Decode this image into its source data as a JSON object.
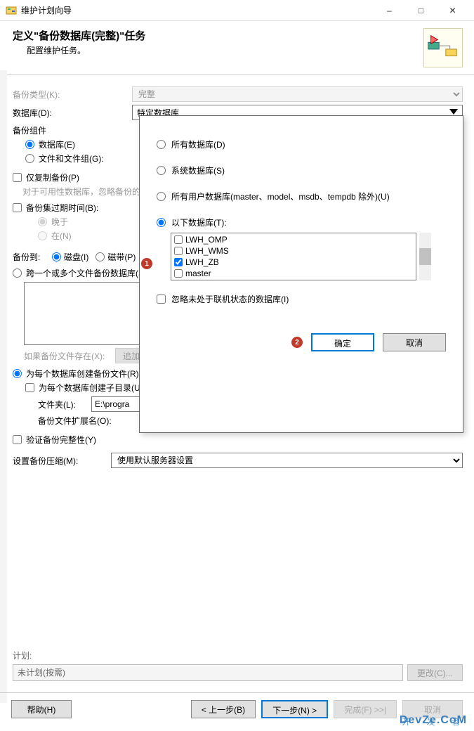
{
  "window": {
    "title": "维护计划向导"
  },
  "header": {
    "title": "定义\"备份数据库(完整)\"任务",
    "subtitle": "配置维护任务。"
  },
  "labels": {
    "backup_type": "备份类型(K):",
    "database": "数据库(D):",
    "backup_component": "备份组件",
    "component_db": "数据库(E)",
    "component_fg": "文件和文件组(G):",
    "copy_only": "仅复制备份(P)",
    "avail_note": "对于可用性数据库，忽略备份的副本设置",
    "expire": "备份集过期时间(B):",
    "expire_after": "晚于",
    "expire_on": "在(N)",
    "backup_to": "备份到:",
    "disk": "磁盘(I)",
    "tape": "磁带(P)",
    "span": "跨一个或多个文件备份数据库(S):",
    "if_exists": "如果备份文件存在(X):",
    "append_btn": "追加",
    "create_per_db": "为每个数据库创建备份文件(R)",
    "create_sub": "为每个数据库创建子目录(U)",
    "folder": "文件夹(L):",
    "folder_value": "E:\\progra",
    "ext": "备份文件扩展名(O):",
    "verify": "验证备份完整性(Y)",
    "compress": "设置备份压缩(M):"
  },
  "values": {
    "backup_type": "完整",
    "database": "特定数据库",
    "compress": "使用默认服务器设置",
    "ext": ""
  },
  "plan": {
    "label": "计划:",
    "value": "未计划(按需)",
    "change_btn": "更改(C)..."
  },
  "buttons": {
    "help": "帮助(H)",
    "back": "< 上一步(B)",
    "next": "下一步(N) >",
    "finish": "完成(F) >>|",
    "cancel": "取消"
  },
  "popup": {
    "opt_all": "所有数据库(D)",
    "opt_sys": "系统数据库(S)",
    "opt_user": "所有用户数据库(master、model、msdb、tempdb 除外)(U)",
    "opt_these": "以下数据库(T):",
    "ignore_offline": "忽略未处于联机状态的数据库(I)",
    "ok": "确定",
    "cancel": "取消",
    "dbs": [
      {
        "name": "LWH_OMP",
        "checked": false
      },
      {
        "name": "LWH_WMS",
        "checked": false
      },
      {
        "name": "LWH_ZB",
        "checked": true
      },
      {
        "name": "master",
        "checked": false
      }
    ]
  },
  "markers": {
    "one": "1",
    "two": "2"
  },
  "watermark": {
    "line1": "开 发 者",
    "line2": "DevZe.CoM"
  }
}
